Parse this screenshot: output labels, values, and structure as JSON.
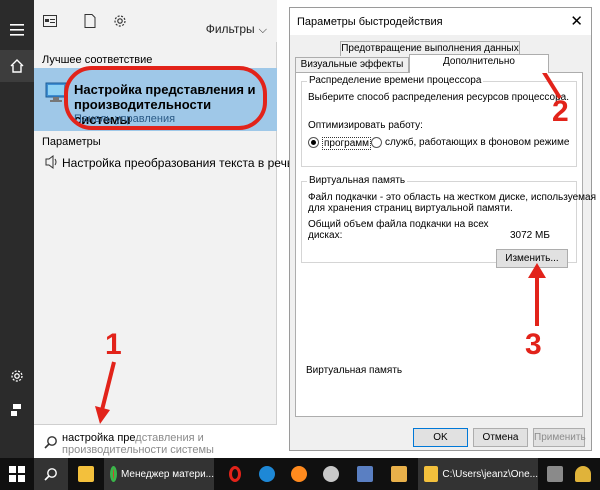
{
  "search_panel": {
    "filters_label": "Фильтры",
    "best_match_header": "Лучшее соответствие",
    "best_match": {
      "title": "Настройка представления и производительности системы",
      "subtitle": "Панель управления"
    },
    "settings_header": "Параметры",
    "settings_item": "Настройка преобразования текста в речь",
    "search_query": "настройка пре",
    "search_suggestion_rest": "дставления и производительности системы"
  },
  "dialog": {
    "title": "Параметры быстродействия",
    "tabs": {
      "dep": "Предотвращение выполнения данных",
      "visual": "Визуальные эффекты",
      "advanced": "Дополнительно"
    },
    "cpu_group": {
      "title": "Распределение времени процессора",
      "description": "Выберите способ распределения ресурсов процессора.",
      "optimize_label": "Оптимизировать работу:",
      "option_programs": "программ",
      "option_services": "служб, работающих в фоновом режиме"
    },
    "vm_group": {
      "title": "Виртуальная память",
      "description_line1": "Файл подкачки - это область на жестком диске, используемая",
      "description_line2": "для хранения страниц виртуальной памяти.",
      "total_line1": "Общий объем файла подкачки на всех",
      "total_line2": "дисках:",
      "total_value": "3072 МБ",
      "change_button": "Изменить..."
    },
    "buttons": {
      "ok": "OK",
      "cancel": "Отмена",
      "apply": "Применить"
    }
  },
  "annotations": {
    "step1": "1",
    "step2": "2",
    "step3": "3"
  },
  "taskbar": {
    "items": [
      {
        "label": "Менеджер матери..."
      },
      {
        "label": "C:\\Users\\jeanz\\One..."
      }
    ]
  },
  "colors": {
    "highlight": "#9fc8e8",
    "annotation_red": "#e2231a",
    "accent": "#0078d7"
  }
}
